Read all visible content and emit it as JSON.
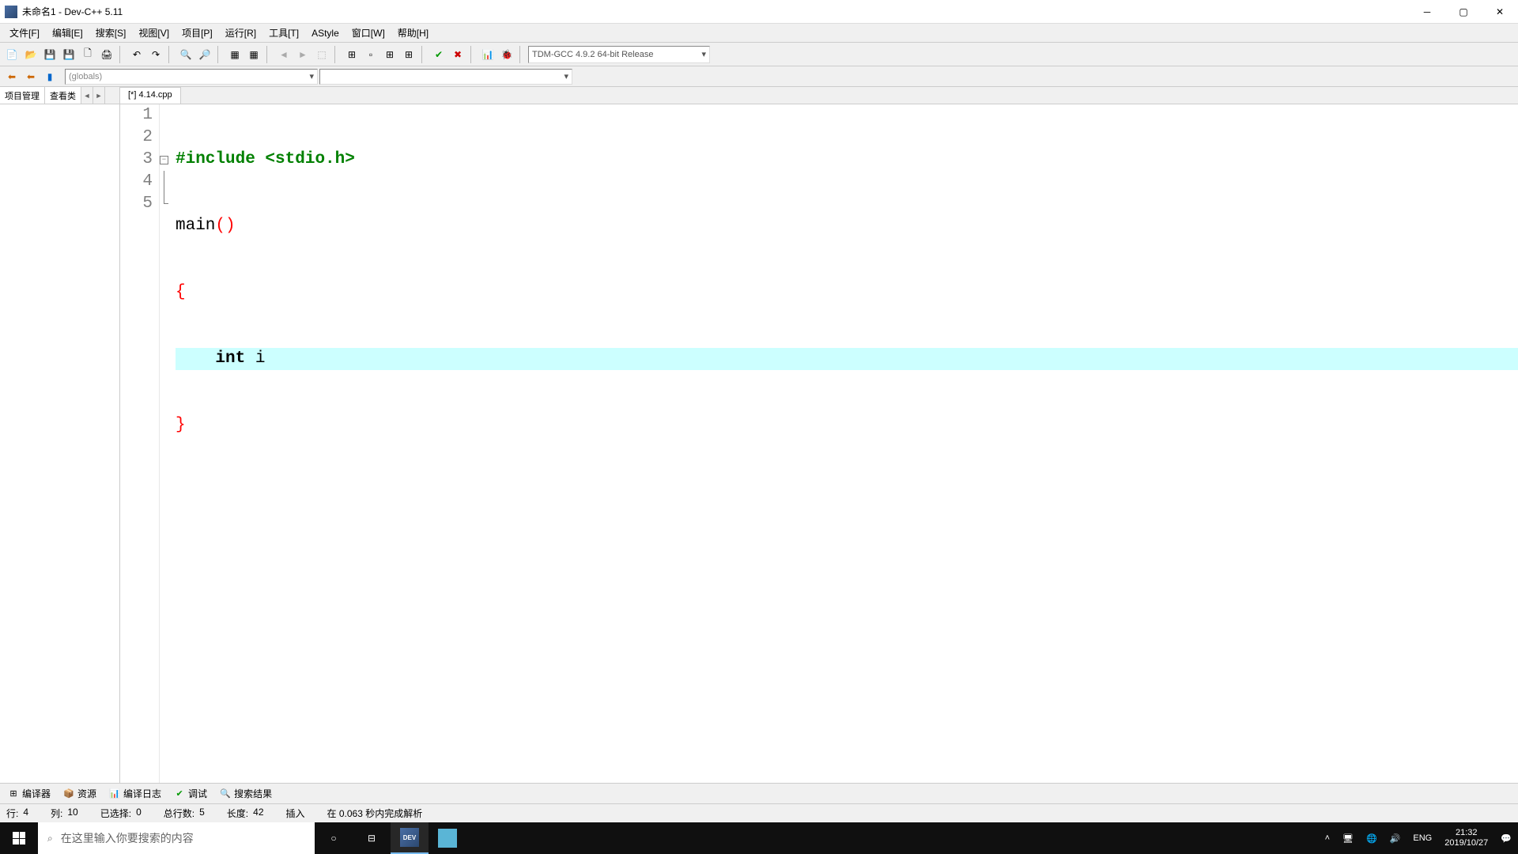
{
  "title": "未命名1 - Dev-C++ 5.11",
  "menu": {
    "file": "文件[F]",
    "edit": "编辑[E]",
    "search": "搜索[S]",
    "view": "视图[V]",
    "project": "项目[P]",
    "run": "运行[R]",
    "tools": "工具[T]",
    "astyle": "AStyle",
    "window": "窗口[W]",
    "help": "帮助[H]"
  },
  "compiler_combo": "TDM-GCC 4.9.2 64-bit Release",
  "scope_combo": "(globals)",
  "sidebar_tabs": {
    "project": "项目管理",
    "classes": "查看类"
  },
  "file_tab": "[*] 4.14.cpp",
  "code": {
    "line1_include": "#include",
    "line1_header": " <stdio.h>",
    "line2_main": "main",
    "line2_paren": "()",
    "line3_brace": "{",
    "line4_indent": "    ",
    "line4_type": "int",
    "line4_var": " i",
    "line5_brace": "}",
    "line_numbers": [
      "1",
      "2",
      "3",
      "4",
      "5"
    ]
  },
  "bottom_tabs": {
    "compiler": "编译器",
    "resources": "资源",
    "compile_log": "编译日志",
    "debug": "调试",
    "search_results": "搜索结果"
  },
  "status": {
    "row_label": "行:",
    "row_value": "4",
    "col_label": "列:",
    "col_value": "10",
    "sel_label": "已选择:",
    "sel_value": "0",
    "total_label": "总行数:",
    "total_value": "5",
    "len_label": "长度:",
    "len_value": "42",
    "mode": "插入",
    "parse": "在 0.063 秒内完成解析"
  },
  "taskbar": {
    "search_placeholder": "在这里输入你要搜索的内容",
    "lang": "ENG",
    "time": "21:32",
    "date": "2019/10/27"
  }
}
